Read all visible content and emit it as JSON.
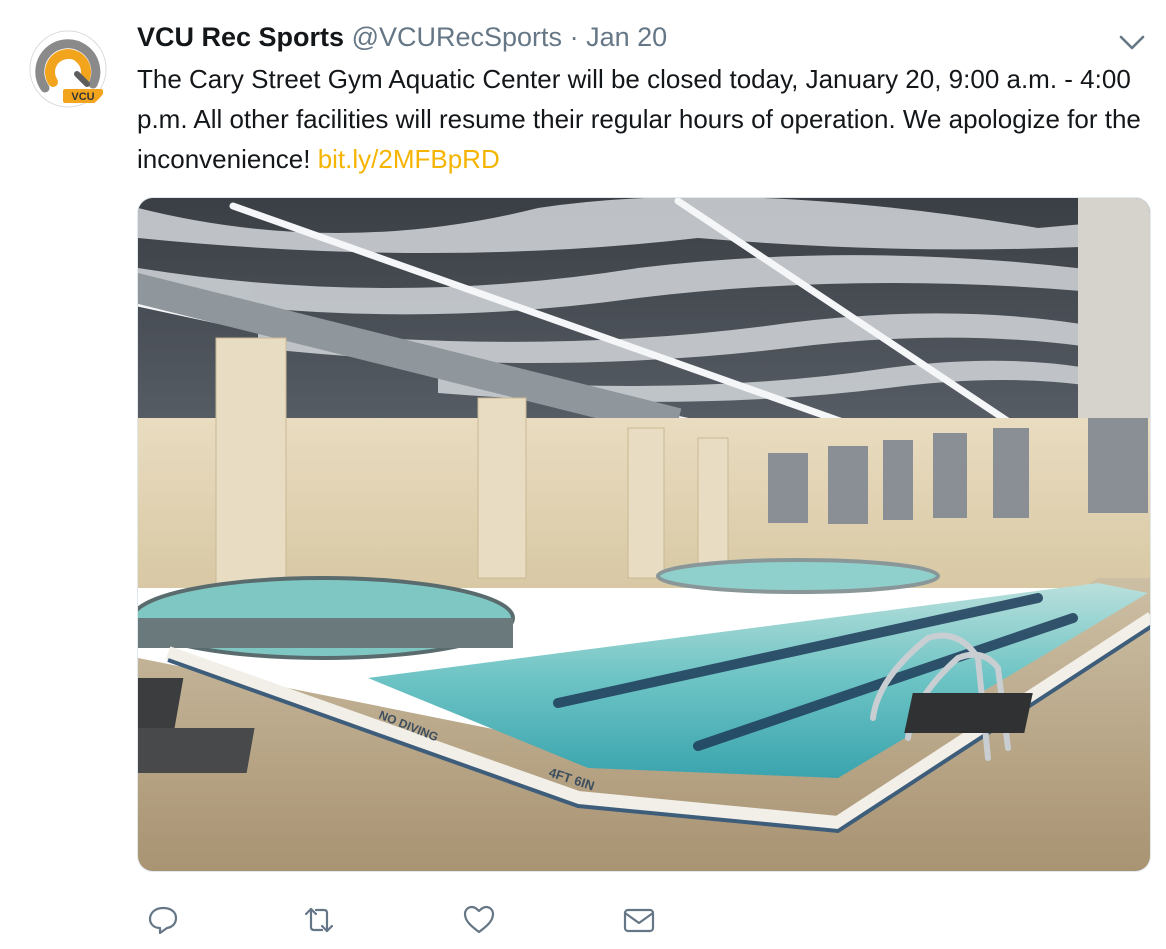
{
  "tweet": {
    "display_name": "VCU Rec Sports",
    "handle": "@VCURecSports",
    "separator": "·",
    "date": "Jan 20",
    "text": "The Cary Street Gym Aquatic Center will be closed today, January 20, 9:00 a.m. - 4:00 p.m.  All other facilities will resume their regular hours of operation. We apologize for the inconvenience! ",
    "link": "bit.ly/2MFBpRD",
    "avatar_icon": "vcu-rec-sports-logo",
    "media": {
      "subject": "indoor-aquatic-center-photo",
      "pool_markings": [
        "NO DIVING",
        "4FT 6IN"
      ]
    }
  },
  "actions": [
    {
      "name": "reply-icon"
    },
    {
      "name": "retweet-icon"
    },
    {
      "name": "like-icon"
    },
    {
      "name": "direct-message-icon"
    }
  ],
  "colors": {
    "link": "#f5b400",
    "secondary_text": "#657786",
    "primary_text": "#14171a",
    "brand_orange": "#f2a51c",
    "action_icon": "#657786"
  }
}
